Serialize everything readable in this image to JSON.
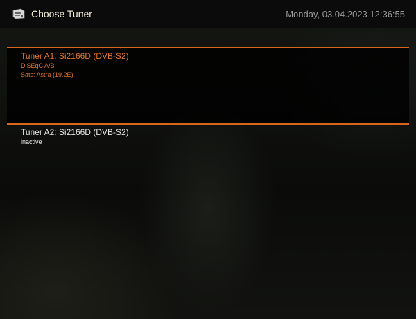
{
  "header": {
    "title": "Choose Tuner",
    "datetime": "Monday, 03.04.2023   12:36:55",
    "icon": "tuner-card-icon"
  },
  "tuners": [
    {
      "name": "Tuner A1: Si2166D (DVB-S2)",
      "lines": [
        "DiSEqC A/B",
        "Sats: Astra (19.2E)"
      ],
      "selected": true
    },
    {
      "name": "Tuner A2: Si2166D (DVB-S2)",
      "lines": [
        "inactive"
      ],
      "selected": false
    }
  ],
  "colors": {
    "accent": "#d9641c",
    "selected_text": "#e0742c",
    "normal_text": "#e6e6e6",
    "title_text": "#f0ead6",
    "datetime_text": "#9a9a9a"
  }
}
